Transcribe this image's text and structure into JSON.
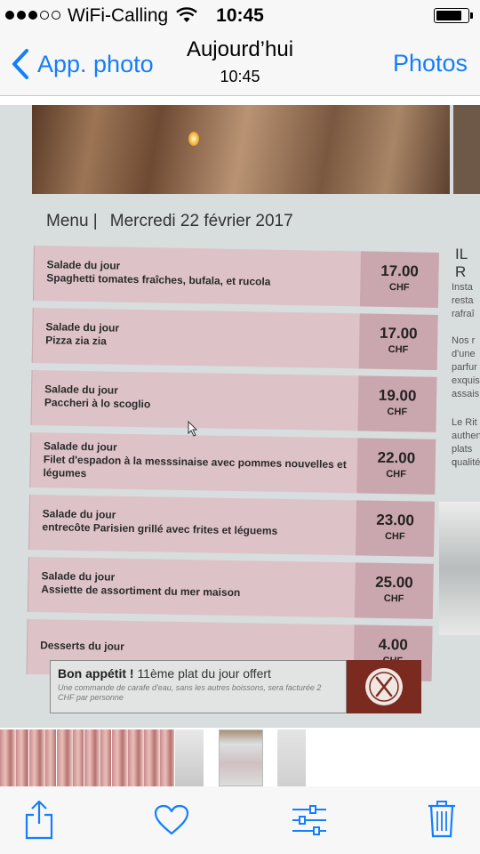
{
  "status_bar": {
    "carrier": "WiFi-Calling",
    "time": "10:45",
    "signal_bars_filled": 3,
    "signal_bars_total": 5,
    "battery_level": 0.85
  },
  "nav": {
    "back_label": "App. photo",
    "title": "Aujourd’hui",
    "subtitle": "10:45",
    "right_label": "Photos"
  },
  "photo": {
    "menu_label": "Menu |",
    "date": "Mercredi 22 février 2017",
    "items": [
      {
        "line1": "Salade du jour",
        "line2": "Spaghetti tomates fraîches, bufala, et rucola",
        "price": "17.00",
        "currency": "CHF"
      },
      {
        "line1": "Salade du jour",
        "line2": "Pizza zia zia",
        "price": "17.00",
        "currency": "CHF"
      },
      {
        "line1": "Salade du jour",
        "line2": "Paccheri à lo scoglio",
        "price": "19.00",
        "currency": "CHF"
      },
      {
        "line1": "Salade du jour",
        "line2": "Filet d'espadon à la messsinaise avec pommes nouvelles et légumes",
        "price": "22.00",
        "currency": "CHF"
      },
      {
        "line1": "Salade du jour",
        "line2": "entrecôte Parisien grillé avec frites et léguems",
        "price": "23.00",
        "currency": "CHF"
      },
      {
        "line1": "Salade du jour",
        "line2": "Assiette de assortiment du mer maison",
        "price": "25.00",
        "currency": "CHF"
      },
      {
        "line1": "Desserts du jour",
        "line2": "",
        "price": "4.00",
        "currency": "CHF"
      }
    ],
    "promo_bold": "Bon appétit !",
    "promo_text": "11ème plat du jour offert",
    "promo_note": "Une commande de carafe d'eau, sans les autres boissons, sera facturée 2 CHF par personne",
    "side_title": "IL R",
    "side_lines": [
      "Insta",
      "resta",
      "rafraî",
      "Nos r",
      "d'une",
      "parfur",
      "exquis",
      "assais",
      "Le Rit",
      "authen",
      "plats q",
      "qualité"
    ]
  },
  "thumbnails": [
    "baby",
    "baby",
    "baby",
    "baby",
    "baby",
    "menu-blur",
    "menu",
    "menu-blur"
  ],
  "toolbar": {
    "share_icon": "share-icon",
    "favorite_icon": "heart-icon",
    "edit_icon": "sliders-icon",
    "delete_icon": "trash-icon"
  },
  "colors": {
    "accent": "#157efb",
    "menu_row": "#ddc3c8",
    "price_cell": "#caa7ae",
    "promo_icon_bg": "#7a2a1f"
  }
}
